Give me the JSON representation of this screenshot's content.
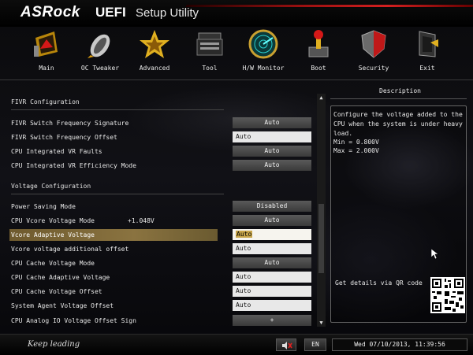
{
  "header": {
    "brand": "ASRock",
    "product": "UEFI",
    "subtitle": "Setup Utility"
  },
  "tabs": [
    {
      "label": "Main",
      "icon": "main-icon"
    },
    {
      "label": "OC Tweaker",
      "icon": "rocket-icon"
    },
    {
      "label": "Advanced",
      "icon": "star-icon"
    },
    {
      "label": "Tool",
      "icon": "toolbox-icon"
    },
    {
      "label": "H/W Monitor",
      "icon": "radar-icon"
    },
    {
      "label": "Boot",
      "icon": "boot-icon"
    },
    {
      "label": "Security",
      "icon": "shield-icon"
    },
    {
      "label": "Exit",
      "icon": "exit-door-icon"
    }
  ],
  "main": {
    "fivr_section": "FIVR Configuration",
    "voltage_section": "Voltage Configuration",
    "rows": [
      {
        "label": "FIVR Switch Frequency Signature",
        "value": "Auto",
        "style": "dark"
      },
      {
        "label": "FIVR Switch Frequency Offset",
        "value": "Auto",
        "style": "light"
      },
      {
        "label": "CPU Integrated VR Faults",
        "value": "Auto",
        "style": "dark"
      },
      {
        "label": "CPU Integrated VR Efficiency Mode",
        "value": "Auto",
        "style": "dark"
      },
      {
        "label": "Power Saving Mode",
        "value": "Disabled",
        "style": "dark"
      },
      {
        "label": "CPU Vcore Voltage Mode",
        "extra": "+1.048V",
        "value": "Auto",
        "style": "dark"
      },
      {
        "label": "Vcore Adaptive Voltage",
        "value": "Auto",
        "style": "selected"
      },
      {
        "label": "Vcore voltage additional offset",
        "value": "Auto",
        "style": "light"
      },
      {
        "label": "CPU Cache Voltage Mode",
        "value": "Auto",
        "style": "dark"
      },
      {
        "label": "CPU Cache Adaptive Voltage",
        "value": "Auto",
        "style": "light"
      },
      {
        "label": "CPU Cache Voltage Offset",
        "value": "Auto",
        "style": "light"
      },
      {
        "label": "System Agent Voltage Offset",
        "value": "Auto",
        "style": "light"
      },
      {
        "label": "CPU Analog IO Voltage Offset Sign",
        "value": "+",
        "style": "dark"
      }
    ]
  },
  "description": {
    "title": "Description",
    "lines": [
      "Configure the voltage added to the",
      "CPU when the system is under heavy",
      "load.",
      "Min = 0.800V",
      "Max = 2.000V"
    ],
    "qr_label": "Get details via QR code"
  },
  "footer": {
    "slogan": "Keep leading",
    "language": "EN",
    "datetime": "Wed 07/10/2013, 11:39:56"
  },
  "colors": {
    "highlight": "#8a7340",
    "accent_red": "#d42020",
    "value_dark": "#4a4a4a",
    "value_light": "#e8e8e8"
  }
}
